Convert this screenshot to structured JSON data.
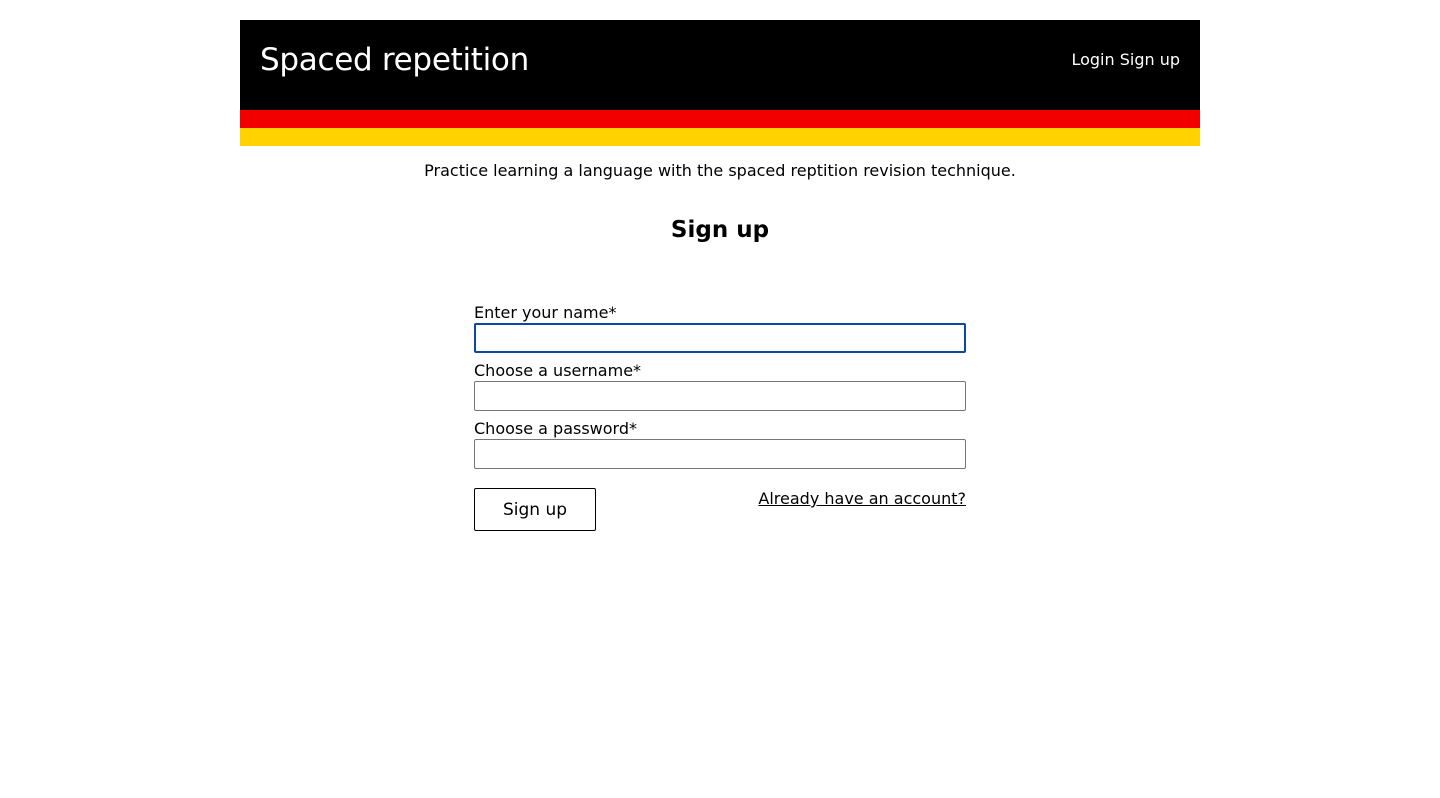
{
  "header": {
    "title": "Spaced repetition",
    "nav": {
      "login": "Login",
      "signup": "Sign up"
    }
  },
  "colors": {
    "header_bg": "#000000",
    "stripe_red": "#f20000",
    "stripe_gold": "#ffd200",
    "focus_border": "#0d47a1"
  },
  "tagline": "Practice learning a language with the spaced reptition revision technique.",
  "form": {
    "heading": "Sign up",
    "name_label": "Enter your name*",
    "name_value": "",
    "username_label": "Choose a username*",
    "username_value": "",
    "password_label": "Choose a password*",
    "password_value": "",
    "submit_label": "Sign up",
    "account_link": "Already have an account?"
  }
}
